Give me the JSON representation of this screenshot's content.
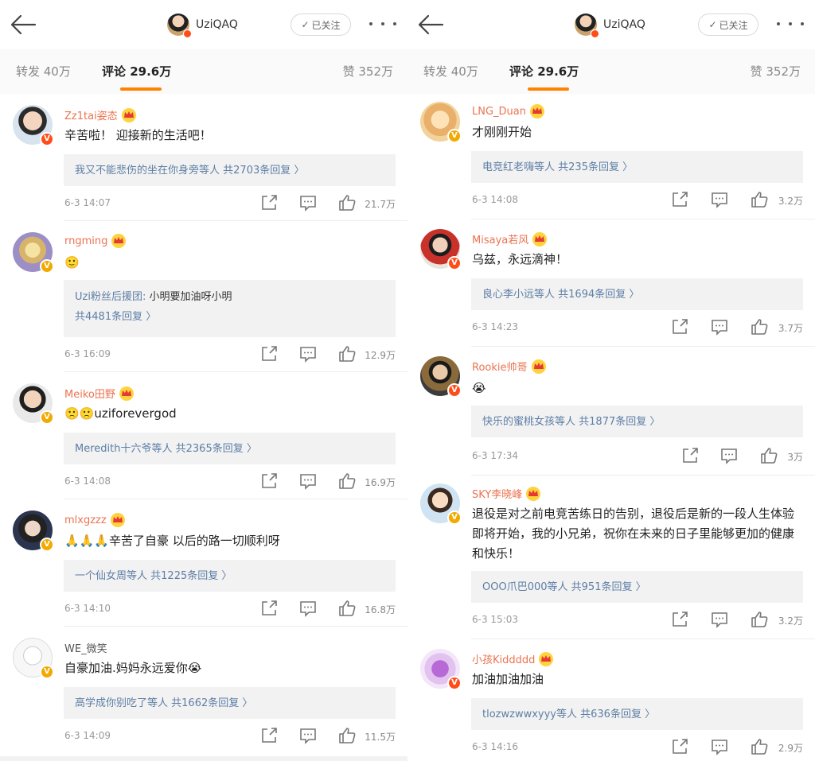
{
  "header": {
    "username": "UziQAQ",
    "follow_label": "已关注",
    "tab_repost": "转发 40万",
    "tab_comment": "评论 29.6万",
    "tab_like": "赞 352万"
  },
  "colors": {
    "accent": "#ff8200",
    "name_orange": "#eb7350",
    "link_blue": "#5d7ea6",
    "verified_red": "#ff4d1a",
    "verified_gold": "#f2a900"
  },
  "left_comments": [
    {
      "name": "Zz1tai姿态",
      "text": "辛苦啦！ 迎接新的生活吧！",
      "reply_user": "",
      "reply_content": "",
      "reply_summary": "我又不能悲伤的坐在你身旁等人",
      "reply_count": "共2703条回复 〉",
      "time": "6-3 14:07",
      "likes": "21.7万"
    },
    {
      "name": "rngming",
      "text": "🙂",
      "reply_user": "Uzi粉丝后援团:",
      "reply_content": " 小明要加油呀小明",
      "reply_summary": "",
      "reply_count": "共4481条回复 〉",
      "time": "6-3 16:09",
      "likes": "12.9万"
    },
    {
      "name": "Meiko田野",
      "text": "🙁🙁uziforevergod",
      "reply_user": "",
      "reply_content": "",
      "reply_summary": "Meredith十六爷等人",
      "reply_count": "共2365条回复 〉",
      "time": "6-3 14:08",
      "likes": "16.9万"
    },
    {
      "name": "mlxgzzz",
      "text": "🙏🙏🙏辛苦了自豪 以后的路一切顺利呀",
      "reply_user": "",
      "reply_content": "",
      "reply_summary": "一个仙女周等人",
      "reply_count": "共1225条回复 〉",
      "time": "6-3 14:10",
      "likes": "16.8万"
    },
    {
      "name": "WE_微笑",
      "text": "自豪加油.妈妈永远爱你😭",
      "reply_user": "",
      "reply_content": "",
      "reply_summary": "高学成你别吃了等人",
      "reply_count": "共1662条回复 〉",
      "time": "6-3 14:09",
      "likes": "11.5万"
    }
  ],
  "right_comments": [
    {
      "name": "LNG_Duan",
      "text": "才刚刚开始",
      "reply_summary": "电竞红老嗨等人",
      "reply_count": "共235条回复 〉",
      "time": "6-3 14:08",
      "likes": "3.2万"
    },
    {
      "name": "Misaya若风",
      "text": "乌兹，永远滴神！",
      "reply_summary": "良心李小远等人",
      "reply_count": "共1694条回复 〉",
      "time": "6-3 14:23",
      "likes": "3.7万"
    },
    {
      "name": "Rookie帅哥",
      "text": "😭",
      "reply_summary": "快乐的蜜桃女孩等人",
      "reply_count": "共1877条回复 〉",
      "time": "6-3 17:34",
      "likes": "3万"
    },
    {
      "name": "SKY李晓峰",
      "text": "退役是对之前电竞苦练日的告别，退役后是新的一段人生体验即将开始，我的小兄弟，祝你在未来的日子里能够更加的健康和快乐！",
      "reply_summary": "OOO爪巴000等人",
      "reply_count": "共951条回复 〉",
      "time": "6-3 15:03",
      "likes": "3.2万"
    },
    {
      "name": "小孩Kiddddd",
      "text": "加油加油加油",
      "reply_summary": "tlozwzwwxyyy等人",
      "reply_count": "共636条回复 〉",
      "time": "6-3 14:16",
      "likes": "2.9万"
    }
  ]
}
